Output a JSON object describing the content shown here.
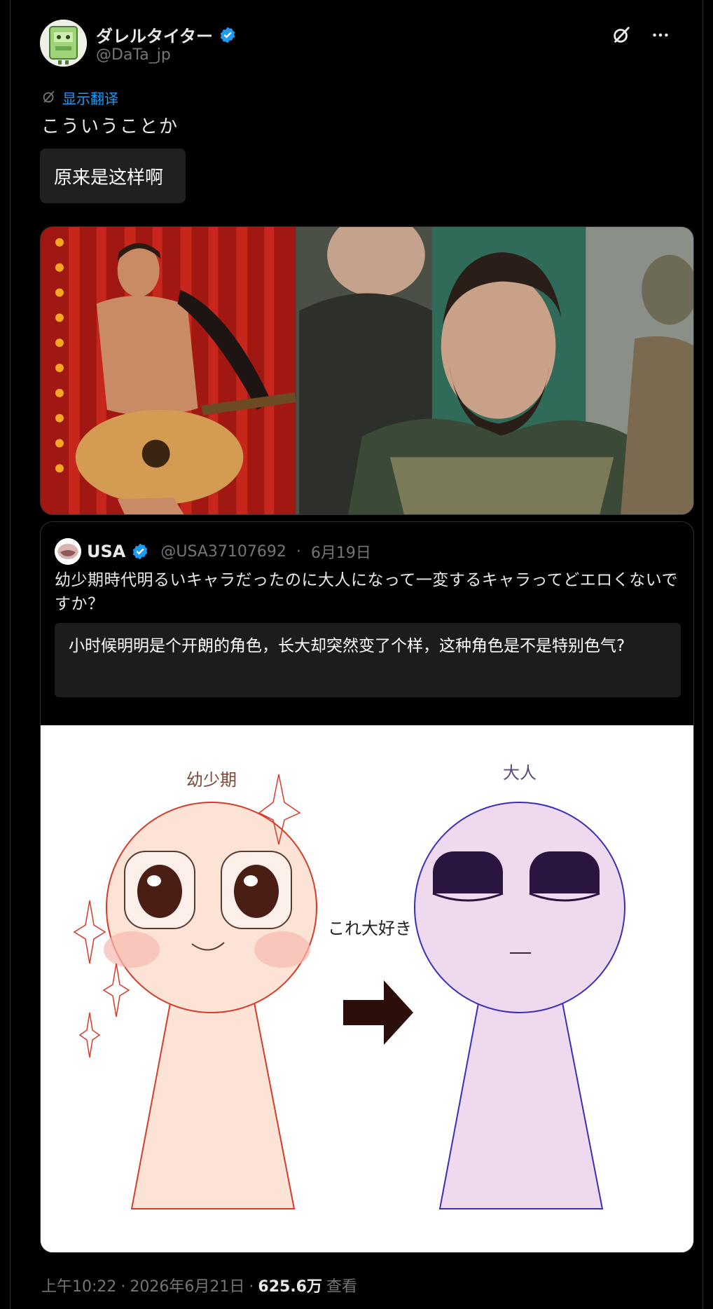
{
  "author": {
    "display_name": "ダレルタイター",
    "handle": "@DaTa_jp",
    "verified": true
  },
  "icons": {
    "verified": "verified-badge-icon",
    "grok": "grok-icon",
    "more": "more-options-icon",
    "translate": "translate-icon"
  },
  "colors": {
    "accent": "#1d9bf0",
    "background": "#000000",
    "muted": "#71767b"
  },
  "tweet": {
    "translate_label": "显示翻译",
    "text": "こういうことか",
    "translation": "原来是这样啊"
  },
  "quote": {
    "display_name": "USA",
    "handle": "@USA37107692",
    "separator": "·",
    "date": "6月19日",
    "text": "幼少期時代明るいキャラだったのに大人になって一変するキャラってどエロくないですか？",
    "translation": "小时候明明是个开朗的角色，长大却突然变了个样，这种角色是不是特别色气?",
    "image_labels": {
      "left": "幼少期",
      "middle": "これ大好き",
      "right": "大人"
    }
  },
  "footer": {
    "time": "上午10:22",
    "sep1": "·",
    "date": "2026年6月21日",
    "sep2": "·",
    "views": "625.6万",
    "views_label": "查看"
  }
}
